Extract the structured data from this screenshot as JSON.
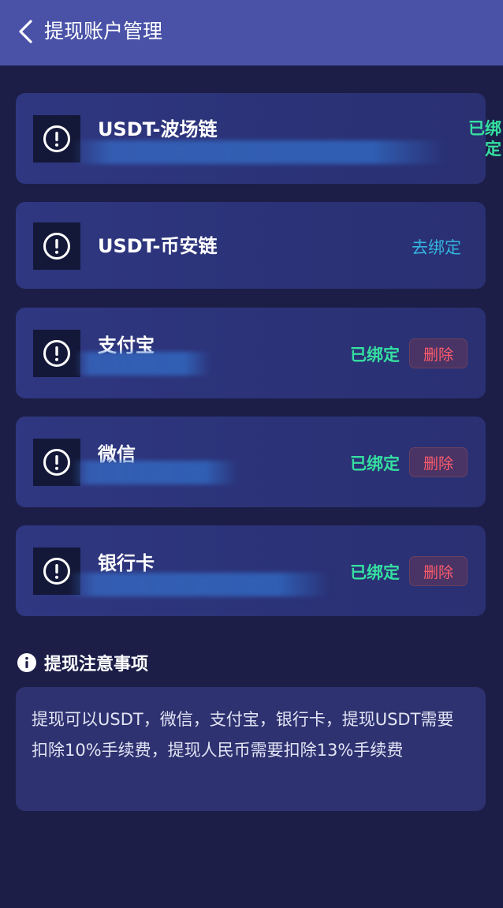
{
  "header": {
    "title": "提现账户管理"
  },
  "accounts": [
    {
      "name": "USDT-波场链",
      "status": "已绑定",
      "status_line1": "已绑",
      "status_line2": "定",
      "action": ""
    },
    {
      "name": "USDT-币安链",
      "status": "",
      "action": "去绑定"
    },
    {
      "name": "支付宝",
      "status": "已绑定",
      "delete_label": "删除"
    },
    {
      "name": "微信",
      "status": "已绑定",
      "delete_label": "删除"
    },
    {
      "name": "银行卡",
      "status": "已绑定",
      "delete_label": "删除"
    }
  ],
  "notice": {
    "title": "提现注意事项",
    "text": "提现可以USDT，微信，支付宝，银行卡，提现USDT需要扣除10%手续费，提现人民币需要扣除13%手续费"
  },
  "colors": {
    "header_bg": "#4a52a8",
    "page_bg": "#1c1e48",
    "bound_status": "#35e0a0",
    "bind_action": "#34b5e0",
    "delete": "#ff5c6c"
  },
  "icons": [
    "back-chevron-icon",
    "alert-circle-icon",
    "info-circle-icon"
  ]
}
